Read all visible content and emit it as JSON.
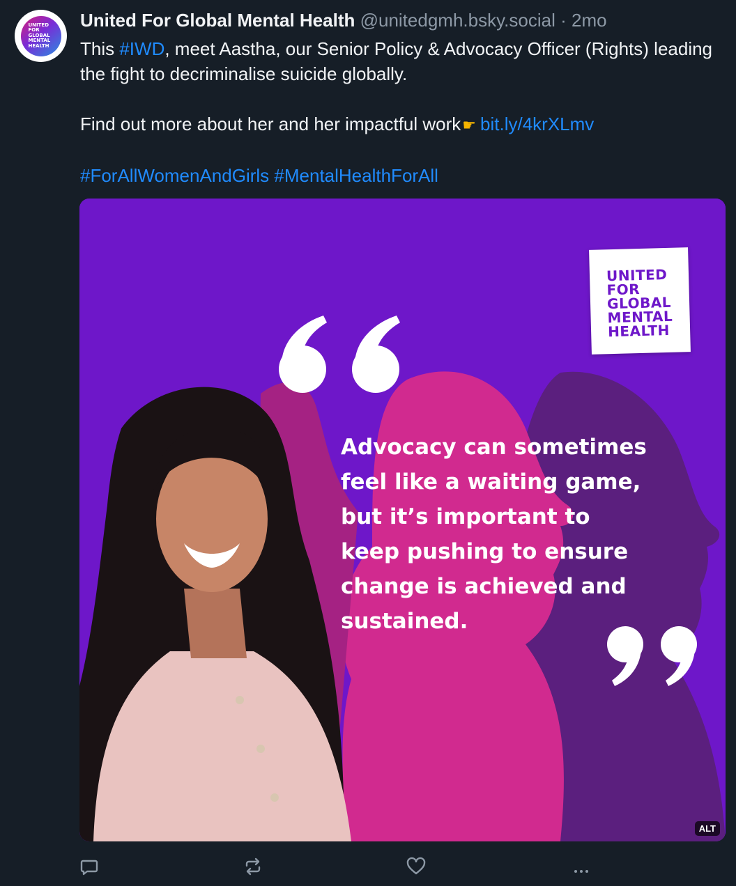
{
  "post": {
    "avatar_lines": [
      "UNITED",
      "FOR",
      "GLOBAL",
      "MENTAL",
      "HEALTH"
    ],
    "display_name": "United For Global Mental Health",
    "handle": "@unitedgmh.bsky.social",
    "separator": "·",
    "time": "2mo",
    "text": {
      "line1_prefix": "This ",
      "hashtag_iwd": "#IWD",
      "line1_rest": ", meet Aastha, our Senior Policy & Advocacy Officer (Rights) leading the fight to decriminalise suicide globally.",
      "line2_prefix": "Find out more about her and her impactful work",
      "emoji_icon": "backhand-index-pointing-right",
      "link": "bit.ly/4krXLmv",
      "hashtag_1": "#ForAllWomenAndGirls",
      "hashtag_2": "#MentalHealthForAll"
    }
  },
  "image": {
    "logo_lines": [
      "UNITED",
      "FOR",
      "GLOBAL",
      "MENTAL",
      "HEALTH"
    ],
    "quote_lines": [
      "Advocacy can sometimes",
      "feel like a waiting game,",
      "but it’s important to",
      "keep pushing to ensure",
      "change is achieved and",
      "sustained."
    ],
    "alt_label": "ALT",
    "colors": {
      "background": "#6e17c9",
      "accent_pink": "#d6207a",
      "text": "#ffffff"
    }
  },
  "actions": {
    "reply_icon": "speech-bubble-icon",
    "repost_icon": "repost-icon",
    "like_icon": "heart-icon",
    "more_icon": "more-dots-icon"
  },
  "colors": {
    "page_bg": "#161e27",
    "link": "#208bfe",
    "muted": "#8d99a6"
  }
}
